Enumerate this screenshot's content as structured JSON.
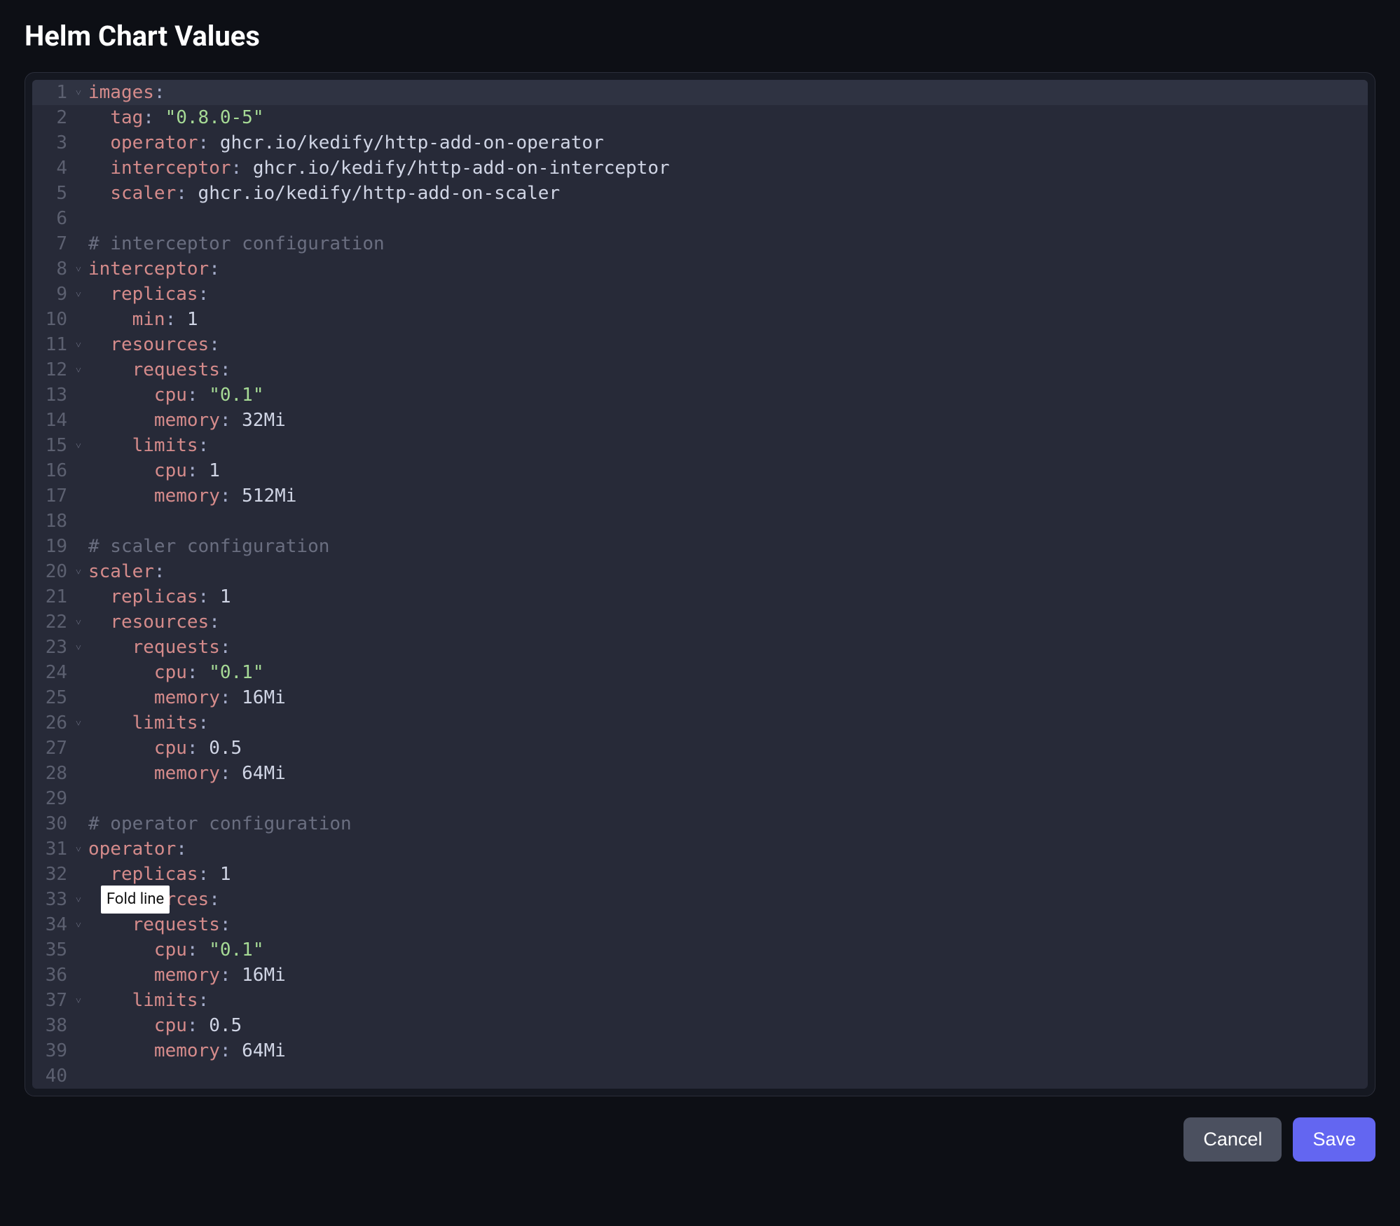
{
  "title": "Helm Chart Values",
  "tooltip": "Fold line",
  "buttons": {
    "cancel": "Cancel",
    "save": "Save"
  },
  "lines": [
    {
      "n": 1,
      "fold": true,
      "active": true,
      "tokens": [
        {
          "t": "key",
          "v": "images"
        },
        {
          "t": "punct",
          "v": ":"
        }
      ]
    },
    {
      "n": 2,
      "fold": false,
      "tokens": [
        {
          "t": "plain",
          "v": "  "
        },
        {
          "t": "key",
          "v": "tag"
        },
        {
          "t": "punct",
          "v": ": "
        },
        {
          "t": "str",
          "v": "\"0.8.0-5\""
        }
      ]
    },
    {
      "n": 3,
      "fold": false,
      "tokens": [
        {
          "t": "plain",
          "v": "  "
        },
        {
          "t": "key",
          "v": "operator"
        },
        {
          "t": "punct",
          "v": ": "
        },
        {
          "t": "val",
          "v": "ghcr.io/kedify/http-add-on-operator"
        }
      ]
    },
    {
      "n": 4,
      "fold": false,
      "tokens": [
        {
          "t": "plain",
          "v": "  "
        },
        {
          "t": "key",
          "v": "interceptor"
        },
        {
          "t": "punct",
          "v": ": "
        },
        {
          "t": "val",
          "v": "ghcr.io/kedify/http-add-on-interceptor"
        }
      ]
    },
    {
      "n": 5,
      "fold": false,
      "tokens": [
        {
          "t": "plain",
          "v": "  "
        },
        {
          "t": "key",
          "v": "scaler"
        },
        {
          "t": "punct",
          "v": ": "
        },
        {
          "t": "val",
          "v": "ghcr.io/kedify/http-add-on-scaler"
        }
      ]
    },
    {
      "n": 6,
      "fold": false,
      "tokens": []
    },
    {
      "n": 7,
      "fold": false,
      "tokens": [
        {
          "t": "comment",
          "v": "# interceptor configuration"
        }
      ]
    },
    {
      "n": 8,
      "fold": true,
      "tokens": [
        {
          "t": "key",
          "v": "interceptor"
        },
        {
          "t": "punct",
          "v": ":"
        }
      ]
    },
    {
      "n": 9,
      "fold": true,
      "tokens": [
        {
          "t": "plain",
          "v": "  "
        },
        {
          "t": "key",
          "v": "replicas"
        },
        {
          "t": "punct",
          "v": ":"
        }
      ]
    },
    {
      "n": 10,
      "fold": false,
      "tokens": [
        {
          "t": "plain",
          "v": "    "
        },
        {
          "t": "key",
          "v": "min"
        },
        {
          "t": "punct",
          "v": ": "
        },
        {
          "t": "num",
          "v": "1"
        }
      ]
    },
    {
      "n": 11,
      "fold": true,
      "tokens": [
        {
          "t": "plain",
          "v": "  "
        },
        {
          "t": "key",
          "v": "resources"
        },
        {
          "t": "punct",
          "v": ":"
        }
      ]
    },
    {
      "n": 12,
      "fold": true,
      "tokens": [
        {
          "t": "plain",
          "v": "    "
        },
        {
          "t": "key",
          "v": "requests"
        },
        {
          "t": "punct",
          "v": ":"
        }
      ]
    },
    {
      "n": 13,
      "fold": false,
      "tokens": [
        {
          "t": "plain",
          "v": "      "
        },
        {
          "t": "key",
          "v": "cpu"
        },
        {
          "t": "punct",
          "v": ": "
        },
        {
          "t": "str",
          "v": "\"0.1\""
        }
      ]
    },
    {
      "n": 14,
      "fold": false,
      "tokens": [
        {
          "t": "plain",
          "v": "      "
        },
        {
          "t": "key",
          "v": "memory"
        },
        {
          "t": "punct",
          "v": ": "
        },
        {
          "t": "val",
          "v": "32Mi"
        }
      ]
    },
    {
      "n": 15,
      "fold": true,
      "tokens": [
        {
          "t": "plain",
          "v": "    "
        },
        {
          "t": "key",
          "v": "limits"
        },
        {
          "t": "punct",
          "v": ":"
        }
      ]
    },
    {
      "n": 16,
      "fold": false,
      "tokens": [
        {
          "t": "plain",
          "v": "      "
        },
        {
          "t": "key",
          "v": "cpu"
        },
        {
          "t": "punct",
          "v": ": "
        },
        {
          "t": "num",
          "v": "1"
        }
      ]
    },
    {
      "n": 17,
      "fold": false,
      "tokens": [
        {
          "t": "plain",
          "v": "      "
        },
        {
          "t": "key",
          "v": "memory"
        },
        {
          "t": "punct",
          "v": ": "
        },
        {
          "t": "val",
          "v": "512Mi"
        }
      ]
    },
    {
      "n": 18,
      "fold": false,
      "tokens": []
    },
    {
      "n": 19,
      "fold": false,
      "tokens": [
        {
          "t": "comment",
          "v": "# scaler configuration"
        }
      ]
    },
    {
      "n": 20,
      "fold": true,
      "tokens": [
        {
          "t": "key",
          "v": "scaler"
        },
        {
          "t": "punct",
          "v": ":"
        }
      ]
    },
    {
      "n": 21,
      "fold": false,
      "tokens": [
        {
          "t": "plain",
          "v": "  "
        },
        {
          "t": "key",
          "v": "replicas"
        },
        {
          "t": "punct",
          "v": ": "
        },
        {
          "t": "num",
          "v": "1"
        }
      ]
    },
    {
      "n": 22,
      "fold": true,
      "tokens": [
        {
          "t": "plain",
          "v": "  "
        },
        {
          "t": "key",
          "v": "resources"
        },
        {
          "t": "punct",
          "v": ":"
        }
      ]
    },
    {
      "n": 23,
      "fold": true,
      "tokens": [
        {
          "t": "plain",
          "v": "    "
        },
        {
          "t": "key",
          "v": "requests"
        },
        {
          "t": "punct",
          "v": ":"
        }
      ]
    },
    {
      "n": 24,
      "fold": false,
      "tokens": [
        {
          "t": "plain",
          "v": "      "
        },
        {
          "t": "key",
          "v": "cpu"
        },
        {
          "t": "punct",
          "v": ": "
        },
        {
          "t": "str",
          "v": "\"0.1\""
        }
      ]
    },
    {
      "n": 25,
      "fold": false,
      "tokens": [
        {
          "t": "plain",
          "v": "      "
        },
        {
          "t": "key",
          "v": "memory"
        },
        {
          "t": "punct",
          "v": ": "
        },
        {
          "t": "val",
          "v": "16Mi"
        }
      ]
    },
    {
      "n": 26,
      "fold": true,
      "tokens": [
        {
          "t": "plain",
          "v": "    "
        },
        {
          "t": "key",
          "v": "limits"
        },
        {
          "t": "punct",
          "v": ":"
        }
      ]
    },
    {
      "n": 27,
      "fold": false,
      "tokens": [
        {
          "t": "plain",
          "v": "      "
        },
        {
          "t": "key",
          "v": "cpu"
        },
        {
          "t": "punct",
          "v": ": "
        },
        {
          "t": "num",
          "v": "0.5"
        }
      ]
    },
    {
      "n": 28,
      "fold": false,
      "tokens": [
        {
          "t": "plain",
          "v": "      "
        },
        {
          "t": "key",
          "v": "memory"
        },
        {
          "t": "punct",
          "v": ": "
        },
        {
          "t": "val",
          "v": "64Mi"
        }
      ]
    },
    {
      "n": 29,
      "fold": false,
      "tokens": []
    },
    {
      "n": 30,
      "fold": false,
      "tokens": [
        {
          "t": "comment",
          "v": "# operator configuration"
        }
      ]
    },
    {
      "n": 31,
      "fold": true,
      "tokens": [
        {
          "t": "key",
          "v": "operator"
        },
        {
          "t": "punct",
          "v": ":"
        }
      ]
    },
    {
      "n": 32,
      "fold": false,
      "tokens": [
        {
          "t": "plain",
          "v": "  "
        },
        {
          "t": "key",
          "v": "replicas"
        },
        {
          "t": "punct",
          "v": ": "
        },
        {
          "t": "num",
          "v": "1"
        }
      ]
    },
    {
      "n": 33,
      "fold": true,
      "tooltip": true,
      "tokens": [
        {
          "t": "plain",
          "v": "  "
        },
        {
          "t": "key",
          "v": "resources"
        },
        {
          "t": "punct",
          "v": ":"
        }
      ]
    },
    {
      "n": 34,
      "fold": true,
      "tokens": [
        {
          "t": "plain",
          "v": "    "
        },
        {
          "t": "key",
          "v": "requests"
        },
        {
          "t": "punct",
          "v": ":"
        }
      ]
    },
    {
      "n": 35,
      "fold": false,
      "tokens": [
        {
          "t": "plain",
          "v": "      "
        },
        {
          "t": "key",
          "v": "cpu"
        },
        {
          "t": "punct",
          "v": ": "
        },
        {
          "t": "str",
          "v": "\"0.1\""
        }
      ]
    },
    {
      "n": 36,
      "fold": false,
      "tokens": [
        {
          "t": "plain",
          "v": "      "
        },
        {
          "t": "key",
          "v": "memory"
        },
        {
          "t": "punct",
          "v": ": "
        },
        {
          "t": "val",
          "v": "16Mi"
        }
      ]
    },
    {
      "n": 37,
      "fold": true,
      "tokens": [
        {
          "t": "plain",
          "v": "    "
        },
        {
          "t": "key",
          "v": "limits"
        },
        {
          "t": "punct",
          "v": ":"
        }
      ]
    },
    {
      "n": 38,
      "fold": false,
      "tokens": [
        {
          "t": "plain",
          "v": "      "
        },
        {
          "t": "key",
          "v": "cpu"
        },
        {
          "t": "punct",
          "v": ": "
        },
        {
          "t": "num",
          "v": "0.5"
        }
      ]
    },
    {
      "n": 39,
      "fold": false,
      "tokens": [
        {
          "t": "plain",
          "v": "      "
        },
        {
          "t": "key",
          "v": "memory"
        },
        {
          "t": "punct",
          "v": ": "
        },
        {
          "t": "val",
          "v": "64Mi"
        }
      ]
    },
    {
      "n": 40,
      "fold": false,
      "tokens": []
    }
  ]
}
